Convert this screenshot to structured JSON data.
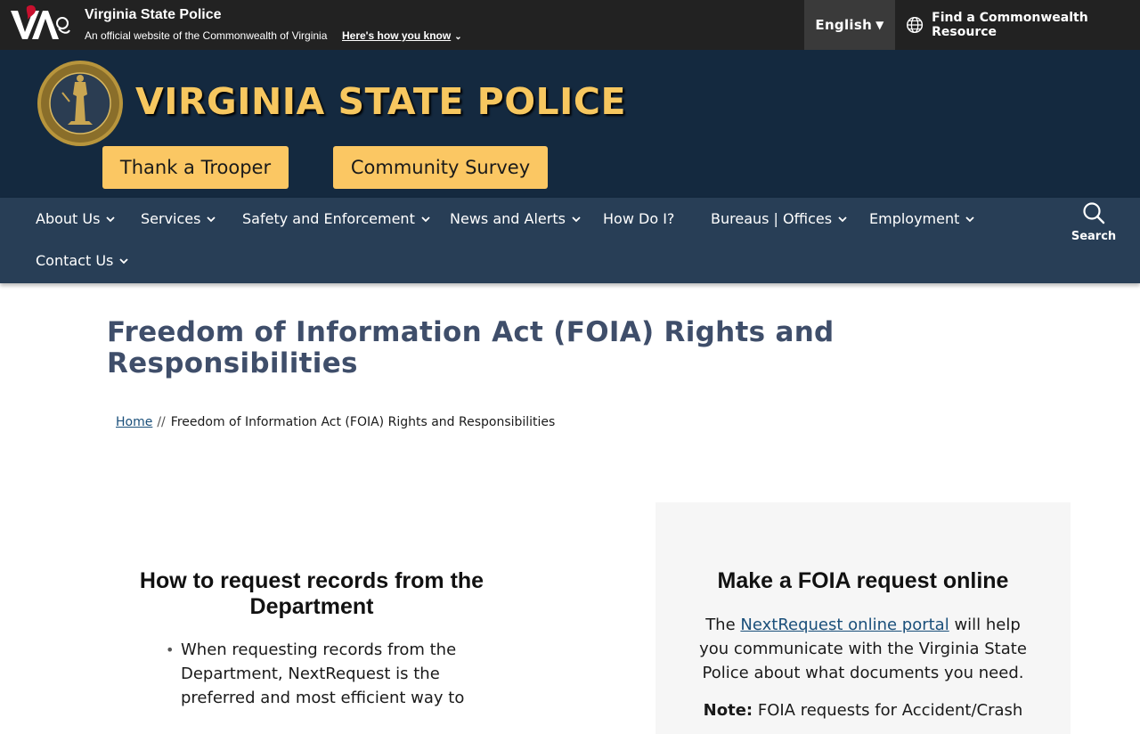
{
  "topbar": {
    "agency_name": "Virginia State Police",
    "official_line": "An official website of the Commonwealth of Virginia",
    "heres_how": "Here's how you know",
    "language": "English",
    "resource": "Find a Commonwealth Resource"
  },
  "header": {
    "site_title": "VIRGINIA STATE POLICE",
    "cta_trooper": "Thank a Trooper",
    "cta_survey": "Community Survey"
  },
  "nav": {
    "items": [
      {
        "label": "About Us"
      },
      {
        "label": "Services"
      },
      {
        "label": "Safety and Enforcement"
      },
      {
        "label": "News and Alerts"
      },
      {
        "label": "How Do I?"
      },
      {
        "label": "Bureaus | Offices"
      },
      {
        "label": "Employment"
      },
      {
        "label": "Contact Us"
      }
    ],
    "search_label": "Search"
  },
  "page": {
    "title": "Freedom of Information Act (FOIA) Rights and Responsibilities",
    "breadcrumb_home": "Home",
    "breadcrumb_sep": "//",
    "breadcrumb_current": "Freedom of Information Act (FOIA) Rights and Responsibilities"
  },
  "left": {
    "heading": "How to request records from the Department",
    "bullet_1": "When requesting records from the Department, NextRequest is the preferred and most efficient way to"
  },
  "right": {
    "heading": "Make a FOIA request online",
    "text_before": "The ",
    "link": "NextRequest online portal",
    "text_after": " will help you communicate with the Virginia State Police about what documents you need.",
    "note_label": "Note:",
    "note_text": " FOIA requests for Accident/Crash"
  },
  "colors": {
    "topbar": "#222222",
    "header": "#14293f",
    "nav": "#283e56",
    "accent_gold": "#fbc763",
    "title_gold": "#f7c75f",
    "page_title": "#3f4e6a",
    "link": "#1a4f7a"
  }
}
